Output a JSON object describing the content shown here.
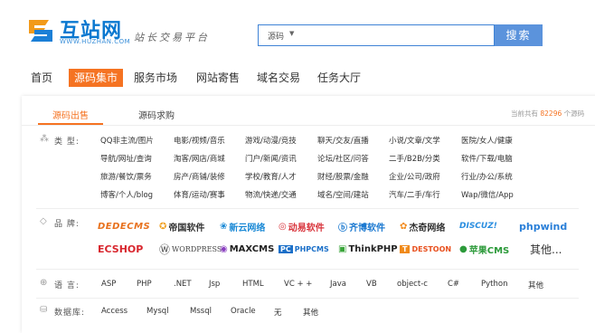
{
  "header": {
    "logo_text": "互站网",
    "logo_url": "WWW.HUZHAN.COM",
    "slogan": "站长交易平台",
    "search_type": "源码",
    "search_button": "搜索"
  },
  "nav": [
    "首页",
    "源码集市",
    "服务市场",
    "网站寄售",
    "域名交易",
    "任务大厅"
  ],
  "tabs": [
    "源码出售",
    "源码求购"
  ],
  "total": {
    "prefix": "当前共有",
    "count": "82296",
    "suffix": "个源码"
  },
  "category": {
    "label": "类 型:",
    "rows": [
      [
        "QQ非主流/图片",
        "电影/视频/音乐",
        "游戏/动漫/竞技",
        "聊天/交友/直播",
        "小说/文章/文学",
        "医院/女人/健康"
      ],
      [
        "导航/网址/查询",
        "淘客/网店/商城",
        "门户/新闻/资讯",
        "论坛/社区/问答",
        "二手/B2B/分类",
        "软件/下载/电脑"
      ],
      [
        "旅游/餐饮/票务",
        "房产/商铺/装修",
        "学校/教育/人才",
        "财经/股票/金融",
        "企业/公司/政府",
        "行业/办公/系统"
      ],
      [
        "博客/个人/blog",
        "体育/运动/赛事",
        "物流/快递/交通",
        "域名/空间/建站",
        "汽车/二手/车行",
        "Wap/微信/App"
      ]
    ]
  },
  "brand": {
    "label": "品 牌:",
    "row1": [
      "DEDECMS",
      "帝国软件",
      "新云网络",
      "动易软件",
      "齐博软件",
      "杰奇网络",
      "DISCUZ!",
      "phpwind"
    ],
    "row2": [
      "ECSHOP",
      "WORDPRESS",
      "MAXCMS",
      "PHPCMS",
      "ThinkPHP",
      "DESTOON",
      "苹果CMS",
      "其他..."
    ]
  },
  "language": {
    "label": "语 言:",
    "items": [
      "ASP",
      "PHP",
      ".NET",
      "Jsp",
      "HTML",
      "VC + +",
      "Java",
      "VB",
      "object-c",
      "C#",
      "Python",
      "其他"
    ]
  },
  "database": {
    "label": "数据库:",
    "items": [
      "Access",
      "Mysql",
      "Mssql",
      "Oracle",
      "无",
      "其他"
    ]
  },
  "colors": {
    "accent": "#f57322",
    "brand_blue": "#0a78d0",
    "search_button": "#5b93dc"
  }
}
